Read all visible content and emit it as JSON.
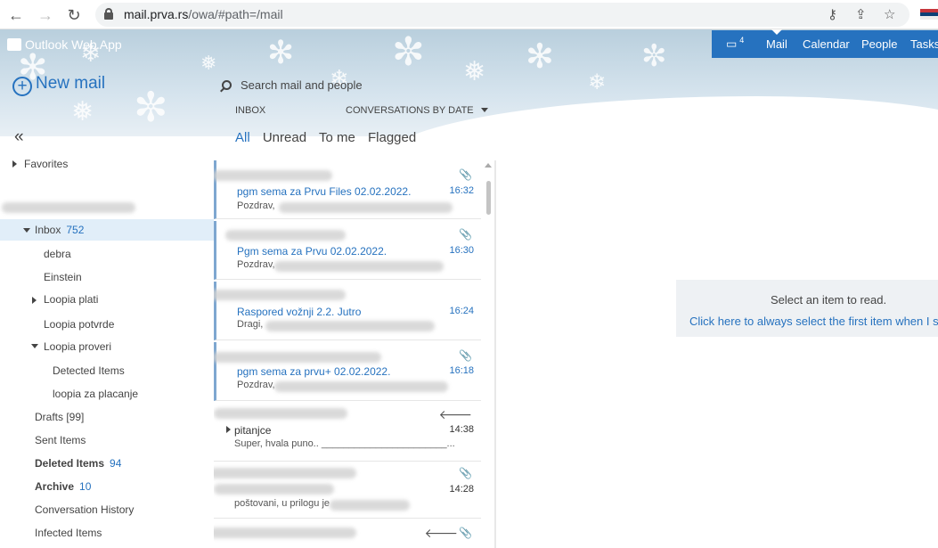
{
  "browser": {
    "url_host": "mail.prva.rs",
    "url_path": "/owa/#path=/mail"
  },
  "owa": {
    "brand": "Outlook Web App",
    "new_mail": "New mail",
    "search_placeholder": "Search mail and people",
    "folder_label": "INBOX",
    "sort_label": "CONVERSATIONS BY DATE",
    "filters": [
      "All",
      "Unread",
      "To me",
      "Flagged"
    ],
    "collapse": "«"
  },
  "top_nav": {
    "calendar_count": "4",
    "items": [
      "Mail",
      "Calendar",
      "People",
      "Tasks"
    ]
  },
  "folders": {
    "favorites": "Favorites",
    "inbox": "Inbox",
    "inbox_count": "752",
    "debra": "debra",
    "einstein": "Einstein",
    "loopia_plati": "Loopia plati",
    "loopia_potvrde": "Loopia potvrde",
    "loopia_proveri": "Loopia proveri",
    "detected_items": "Detected Items",
    "loopia_za_placanje": "loopia za placanje",
    "drafts": "Drafts [99]",
    "sent_items": "Sent Items",
    "deleted_items": "Deleted Items",
    "deleted_count": "94",
    "archive": "Archive",
    "archive_count": "10",
    "conversation_history": "Conversation History",
    "infected_items": "Infected Items"
  },
  "messages": [
    {
      "subject": "pgm sema za Prvu Files 02.02.2022.",
      "time": "16:32",
      "preview": "Pozdrav,",
      "attachment": true
    },
    {
      "subject": "Pgm sema za Prvu 02.02.2022.",
      "time": "16:30",
      "preview": "Pozdrav,",
      "attachment": true
    },
    {
      "subject": "Raspored vožnji 2.2. Jutro",
      "time": "16:24",
      "preview": "Dragi,",
      "attachment": false
    },
    {
      "subject": "pgm sema za prvu+ 02.02.2022.",
      "time": "16:18",
      "preview": "Pozdrav,",
      "attachment": true
    },
    {
      "subject": "pitanjce",
      "time": "14:38",
      "preview": "Super, hvala puno.. _______________________...",
      "replied": true
    },
    {
      "subject": "",
      "time": "14:28",
      "preview": "poštovani, u prilogu je",
      "attachment": true
    }
  ],
  "reading_pane": {
    "select_item": "Select an item to read.",
    "always_select": "Click here to always select the first item when I si"
  }
}
